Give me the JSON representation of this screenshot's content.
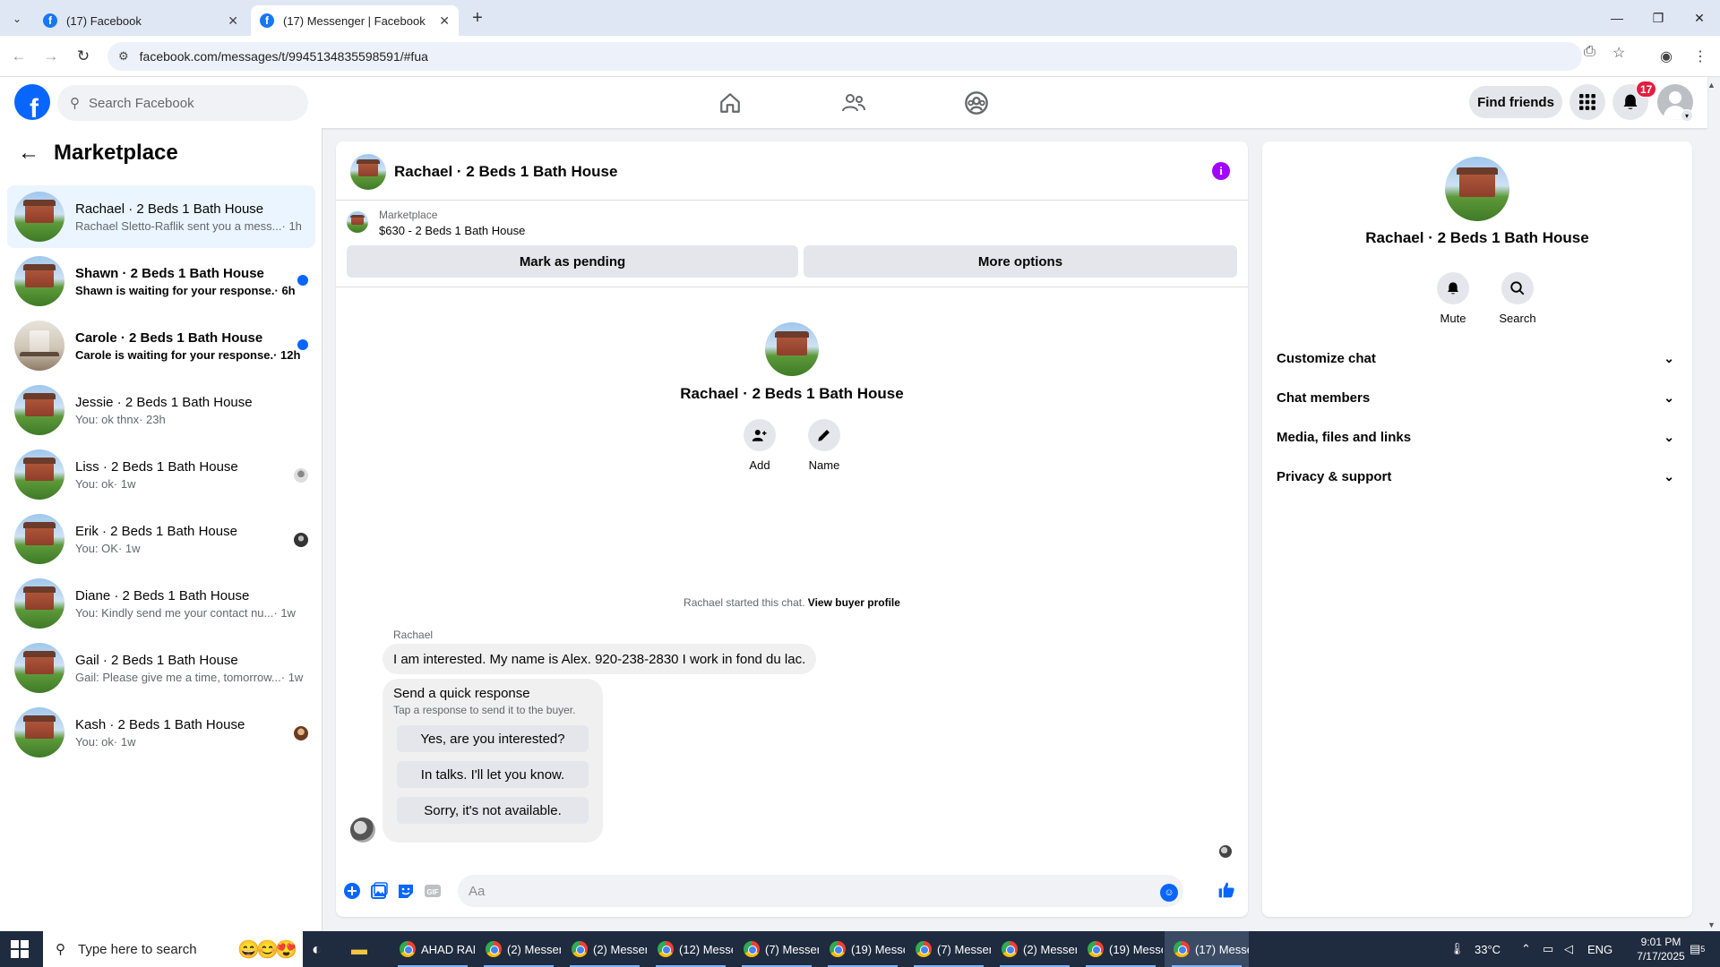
{
  "browser": {
    "tabs": [
      {
        "title": "(17) Facebook",
        "active": false
      },
      {
        "title": "(17) Messenger | Facebook",
        "active": true
      }
    ],
    "url": "facebook.com/messages/t/9945134835598591/#fua"
  },
  "header": {
    "search_placeholder": "Search Facebook",
    "find_friends": "Find friends",
    "notification_count": "17"
  },
  "sidebar": {
    "title": "Marketplace",
    "conversations": [
      {
        "name": "Rachael · 2 Beds 1 Bath House",
        "snippet": "Rachael Sletto-Raflik sent you a mess...",
        "time": " · 1h",
        "active": true,
        "unread": false,
        "thumb": "house"
      },
      {
        "name": "Shawn · 2 Beds 1 Bath House",
        "snippet": "Shawn is waiting for your response.",
        "time": " · 6h",
        "active": false,
        "unread": true,
        "thumb": "house"
      },
      {
        "name": "Carole · 2 Beds 1 Bath House",
        "snippet": "Carole is waiting for your response.",
        "time": " · 12h",
        "active": false,
        "unread": true,
        "thumb": "interior"
      },
      {
        "name": "Jessie · 2 Beds 1 Bath House",
        "snippet": "You: ok thnx",
        "time": " · 23h",
        "active": false,
        "unread": false,
        "thumb": "house"
      },
      {
        "name": "Liss · 2 Beds 1 Bath House",
        "snippet": "You: ok",
        "time": " · 1w",
        "active": false,
        "unread": false,
        "thumb": "house"
      },
      {
        "name": "Erik · 2 Beds 1 Bath House",
        "snippet": "You: OK",
        "time": " · 1w",
        "active": false,
        "unread": false,
        "thumb": "house"
      },
      {
        "name": "Diane · 2 Beds 1 Bath House",
        "snippet": "You: Kindly send me your contact nu...",
        "time": " · 1w",
        "active": false,
        "unread": false,
        "thumb": "house"
      },
      {
        "name": "Gail · 2 Beds 1 Bath House",
        "snippet": "Gail: Please give me a time, tomorrow...",
        "time": " · 1w",
        "active": false,
        "unread": false,
        "thumb": "house"
      },
      {
        "name": "Kash · 2 Beds 1 Bath House",
        "snippet": "You: ok",
        "time": " · 1w",
        "active": false,
        "unread": false,
        "thumb": "house"
      }
    ]
  },
  "chat": {
    "title": "Rachael · 2 Beds 1 Bath House",
    "listing_source": "Marketplace",
    "listing_title": "$630 - 2 Beds 1 Bath House",
    "mark_pending": "Mark as pending",
    "more_options": "More options",
    "intro_name": "Rachael · 2 Beds 1 Bath House",
    "add_label": "Add",
    "name_label": "Name",
    "started_text": "Rachael started this chat.",
    "view_buyer": "View buyer profile",
    "sender": "Rachael",
    "message": "I am interested. My name is Alex. 920-238-2830 I work in fond du lac.",
    "quick_title": "Send a quick response",
    "quick_subtitle": "Tap a response to send it to the buyer.",
    "quick_responses": [
      "Yes, are you interested?",
      "In talks. I'll let you know.",
      "Sorry, it's not available."
    ],
    "input_placeholder": "Aa"
  },
  "details": {
    "name": "Rachael · 2 Beds 1 Bath House",
    "mute": "Mute",
    "search": "Search",
    "sections": [
      "Customize chat",
      "Chat members",
      "Media, files and links",
      "Privacy & support"
    ]
  },
  "taskbar": {
    "search_placeholder": "Type here to search",
    "apps": [
      {
        "label": "AHAD RAM...",
        "active": false
      },
      {
        "label": "(2) Messen...",
        "active": false
      },
      {
        "label": "(2) Messen...",
        "active": false
      },
      {
        "label": "(12) Messen...",
        "active": false
      },
      {
        "label": "(7) Messen...",
        "active": false
      },
      {
        "label": "(19) Messen...",
        "active": false
      },
      {
        "label": "(7) Messen...",
        "active": false
      },
      {
        "label": "(2) Messen...",
        "active": false
      },
      {
        "label": "(19) Messe...",
        "active": false
      },
      {
        "label": "(17) Messe...",
        "active": true
      }
    ],
    "temperature": "33°C",
    "language": "ENG",
    "time": "9:01 PM",
    "date": "7/17/2025",
    "notif_count": "5"
  },
  "colors": {
    "facebook_blue": "#0866ff",
    "active_row": "#ebf5ff",
    "info_purple": "#a100ff",
    "badge_red": "#e41e3f"
  }
}
